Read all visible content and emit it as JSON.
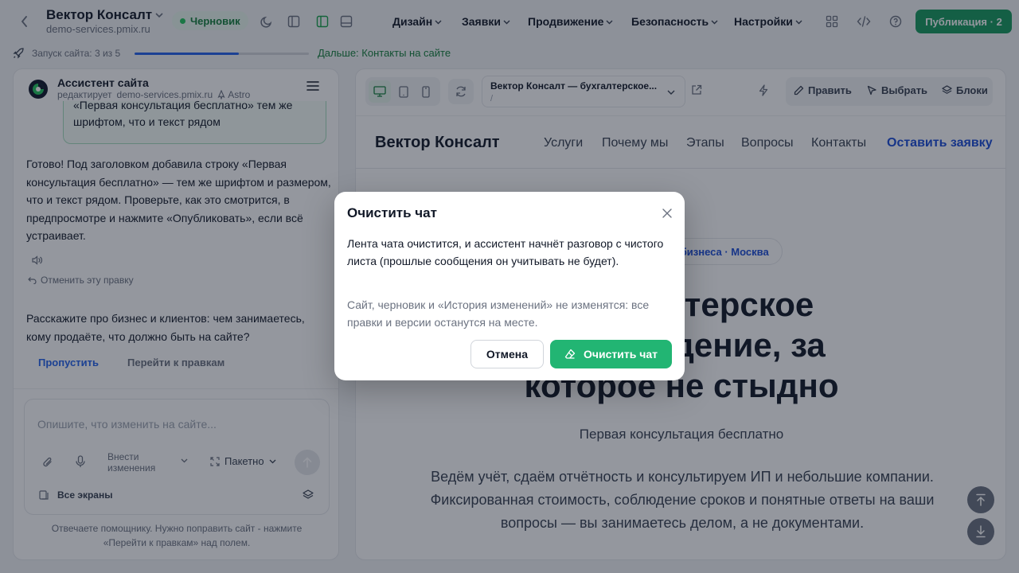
{
  "header": {
    "site_title": "Вектор Консалт",
    "site_domain": "demo-services.pmix.ru",
    "status_badge": "Черновик",
    "nav": [
      "Дизайн",
      "Заявки",
      "Продвижение",
      "Безопасность",
      "Настройки"
    ],
    "publish_label": "Публикация · 2",
    "publish_color": "#179a5d"
  },
  "progress": {
    "label": "Запуск сайта: 3 из 5",
    "value": 0.6,
    "next_link": "Дальше: Контакты на сайте"
  },
  "assistant": {
    "name": "Ассистент сайта",
    "editing_prefix": "редактирует",
    "editing_domain": "demo-services.pmix.ru",
    "framework": "Astro",
    "user_message": "«Первая консультация бесплатно» тем же шрифтом, что и текст рядом",
    "reply": "Готово! Под заголовком добавила строку «Первая консультация бесплатно» — тем же шрифтом и размером, что и текст рядом. Проверьте, как это смотрится, в предпросмотре и нажмите «Опубликовать», если всё устраивает.",
    "undo_label": "Отменить эту правку",
    "question": "Расскажите про бизнес и клиентов: чем занимаетесь, кому продаёте, что должно быть на сайте?",
    "skip_label": "Пропустить",
    "goto_label": "Перейти к правкам",
    "composer_placeholder": "Опишите, что изменить на сайте...",
    "mode_label": "Внести изменения",
    "batch_label": "Пакетно",
    "screens_label": "Все экраны",
    "footer_note": "Отвечаете помощнику. Нужно поправить сайт - нажмите «Перейти к правкам» над полем."
  },
  "preview_toolbar": {
    "page_title": "Вектор Консалт — бухгалтерское...",
    "page_path": "/",
    "edit_label": "Править",
    "select_label": "Выбрать",
    "blocks_label": "Блоки"
  },
  "preview": {
    "logo": "Вектор Консалт",
    "nav": [
      "Услуги",
      "Почему мы",
      "Этапы",
      "Вопросы",
      "Контакты"
    ],
    "cta": "Оставить заявку",
    "pill": "ого бизнеса · Москва",
    "heading_lines": [
      "терское",
      "дение, за",
      "которое не стыдно"
    ],
    "subtitle": "Первая консультация бесплатно",
    "description": "Ведём учёт, сдаём отчётность и консультируем ИП и небольшие компании. Фиксированная стоимость, соблюдение сроков и понятные ответы на ваши вопросы — вы занимаетесь делом, а не документами."
  },
  "modal": {
    "title": "Очистить чат",
    "body": "Лента чата очистится, и ассистент начнёт разговор с чистого листа (прошлые сообщения он учитывать не будет).",
    "note": "Сайт, черновик и «История изменений» не изменятся: все правки и версии останутся на месте.",
    "cancel_label": "Отмена",
    "confirm_label": "Очистить чат",
    "confirm_color": "#22b573"
  }
}
